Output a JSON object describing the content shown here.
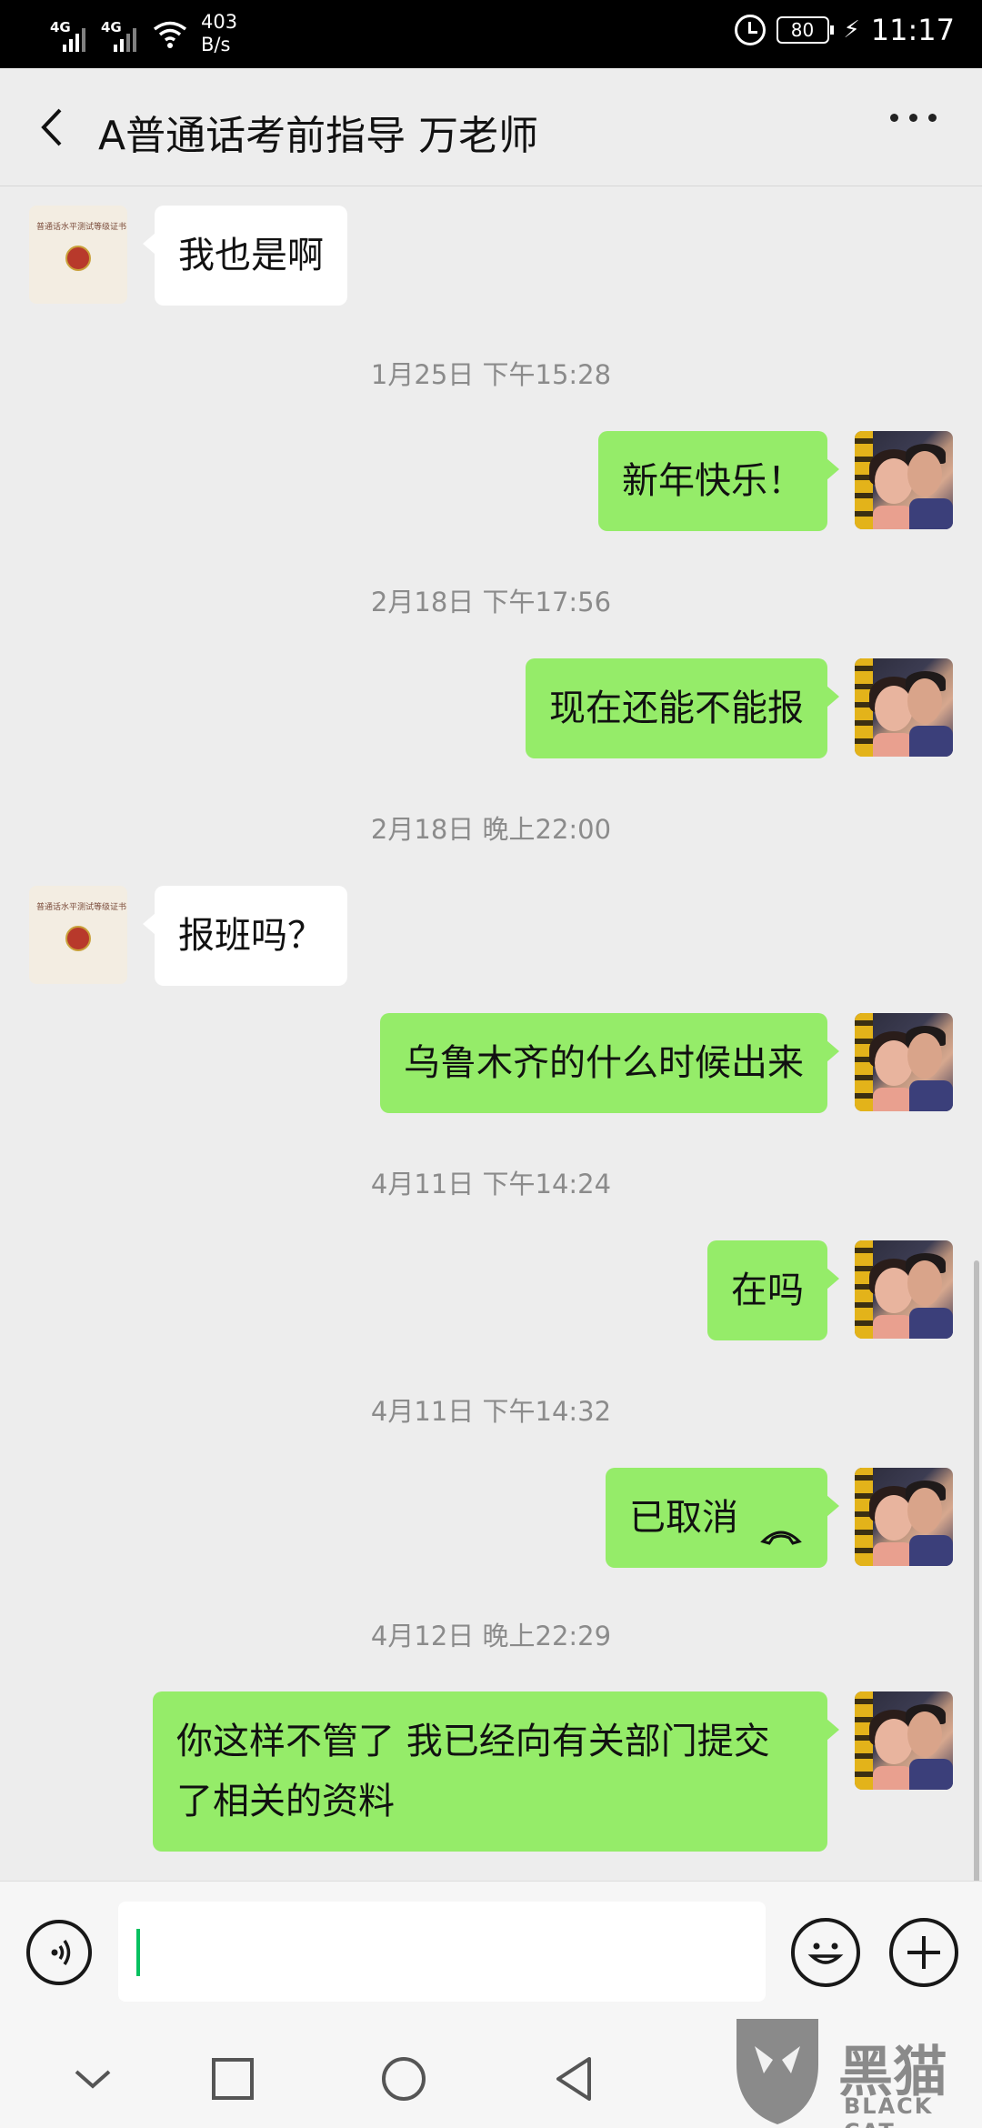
{
  "status_bar": {
    "net1": "4G",
    "net2": "4G",
    "speed_value": "403",
    "speed_unit": "B/s",
    "battery": "80",
    "time": "11:17"
  },
  "header": {
    "title": "A普通话考前指导 万老师",
    "back_icon": "chevron-left-icon",
    "more_icon": "more-dots-icon"
  },
  "teacher_avatar": {
    "cert_text": "普通话水平测试等级证书"
  },
  "messages": [
    {
      "type": "in",
      "text": "我也是啊"
    },
    {
      "type": "time",
      "text": "1月25日 下午15:28"
    },
    {
      "type": "out",
      "text": "新年快乐！"
    },
    {
      "type": "time",
      "text": "2月18日 下午17:56"
    },
    {
      "type": "out",
      "text": "现在还能不能报"
    },
    {
      "type": "time",
      "text": "2月18日 晚上22:00"
    },
    {
      "type": "in",
      "text": "报班吗？"
    },
    {
      "type": "out",
      "text": "乌鲁木齐的什么时候出来"
    },
    {
      "type": "time",
      "text": "4月11日 下午14:24"
    },
    {
      "type": "out",
      "text": "在吗"
    },
    {
      "type": "time",
      "text": "4月11日 下午14:32"
    },
    {
      "type": "out",
      "text": "已取消",
      "icon": "phone-hangup-icon"
    },
    {
      "type": "time",
      "text": "4月12日 晚上22:29"
    },
    {
      "type": "out",
      "text": "你这样不管了 我已经向有关部门提交了相关的资料"
    }
  ],
  "input_bar": {
    "voice_icon": "voice-icon",
    "emoji_icon": "emoji-icon",
    "plus_icon": "plus-icon"
  },
  "nav_bar": {
    "items": [
      "hide-keyboard-icon",
      "recents-icon",
      "home-icon",
      "back-icon"
    ]
  },
  "watermark": {
    "text": "黑猫",
    "sub": "BLACK CAT"
  },
  "colors": {
    "out_bubble": "#95ec69",
    "in_bubble": "#ffffff",
    "background": "#ededed",
    "caret": "#07c160"
  }
}
